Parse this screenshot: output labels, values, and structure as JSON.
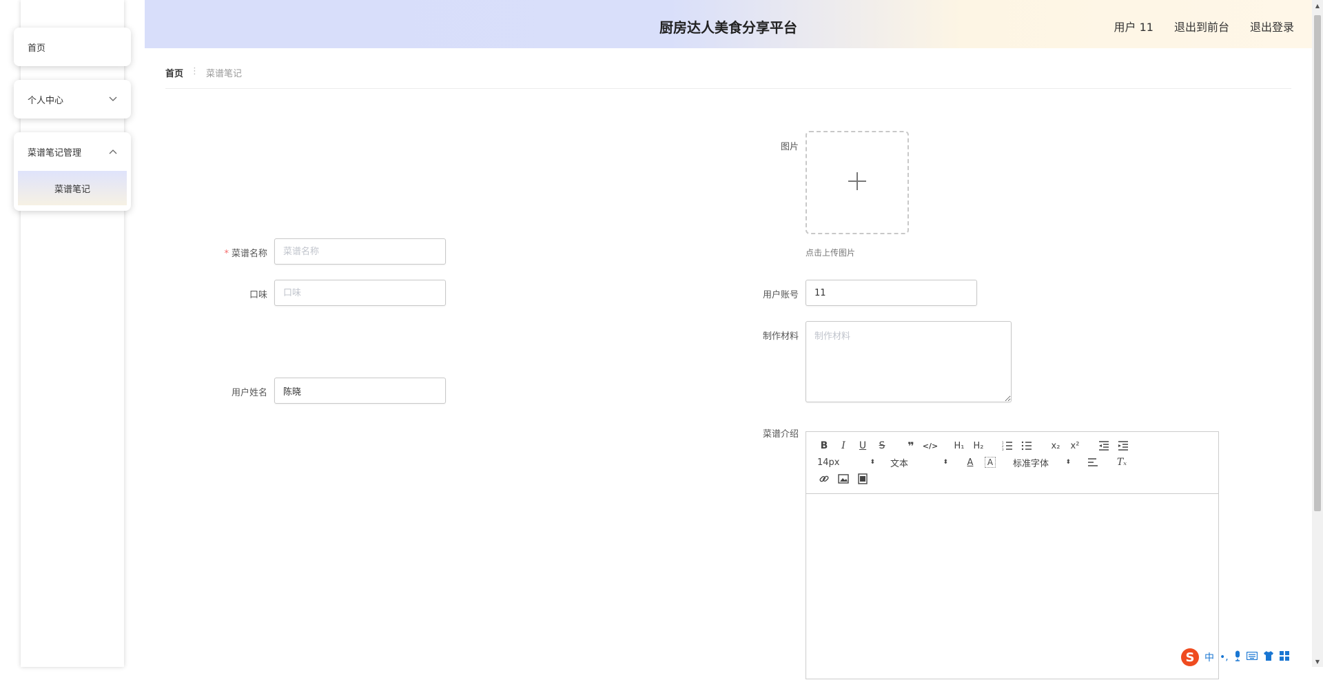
{
  "sidebar": {
    "home": "首页",
    "personal_center": "个人中心",
    "recipe_management": "菜谱笔记管理",
    "recipe_notes": "菜谱笔记"
  },
  "header": {
    "title": "厨房达人美食分享平台",
    "user": "用户 11",
    "back_to_front": "退出到前台",
    "logout": "退出登录"
  },
  "breadcrumb": {
    "home": "首页",
    "current": "菜谱笔记"
  },
  "form": {
    "image_label": "图片",
    "upload_hint": "点击上传图片",
    "recipe_name_label": "菜谱名称",
    "recipe_name_placeholder": "菜谱名称",
    "taste_label": "口味",
    "taste_placeholder": "口味",
    "user_account_label": "用户账号",
    "user_account_value": "11",
    "materials_label": "制作材料",
    "materials_placeholder": "制作材料",
    "user_name_label": "用户姓名",
    "user_name_value": "陈晓",
    "intro_label": "菜谱介绍"
  },
  "editor": {
    "font_size": "14px",
    "paragraph": "文本",
    "font_family": "标准字体"
  },
  "ime": {
    "mode": "中"
  }
}
